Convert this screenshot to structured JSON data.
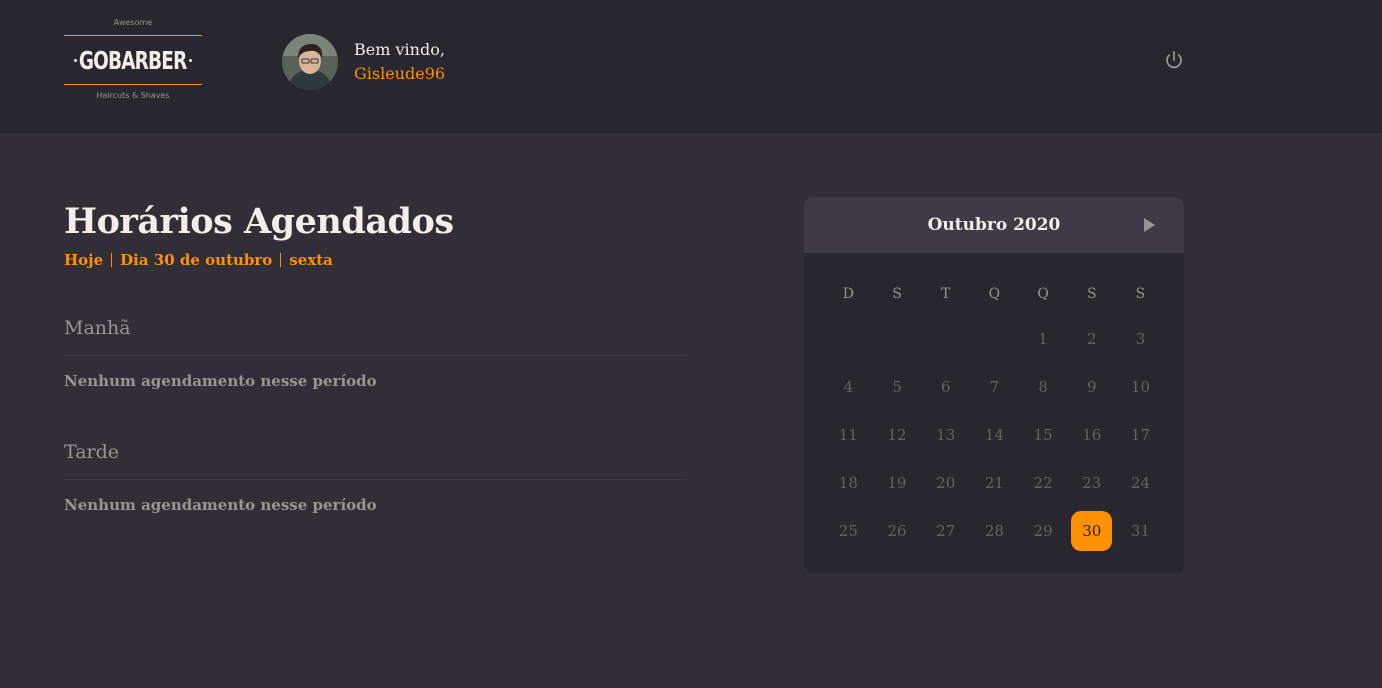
{
  "header": {
    "logo": {
      "top_text": "Awesome",
      "brand": "GOBARBER",
      "bottom_text": "Haircuts & Shaves"
    },
    "welcome": "Bem vindo,",
    "username": "Gisleude96",
    "power_icon": "power-icon"
  },
  "schedule": {
    "title": "Horários Agendados",
    "date": {
      "today": "Hoje",
      "day": "Dia 30 de outubro",
      "weekday": "sexta"
    },
    "sections": [
      {
        "title": "Manhã",
        "empty": "Nenhum agendamento nesse período"
      },
      {
        "title": "Tarde",
        "empty": "Nenhum agendamento nesse período"
      }
    ]
  },
  "calendar": {
    "month": "Outubro 2020",
    "next_icon": "triangle-right-icon",
    "weekdays": [
      "D",
      "S",
      "T",
      "Q",
      "Q",
      "S",
      "S"
    ],
    "weeks": [
      [
        "",
        "",
        "",
        "",
        "1",
        "2",
        "3"
      ],
      [
        "4",
        "5",
        "6",
        "7",
        "8",
        "9",
        "10"
      ],
      [
        "11",
        "12",
        "13",
        "14",
        "15",
        "16",
        "17"
      ],
      [
        "18",
        "19",
        "20",
        "21",
        "22",
        "23",
        "24"
      ],
      [
        "25",
        "26",
        "27",
        "28",
        "29",
        "30",
        "31"
      ]
    ],
    "selected": "30"
  },
  "colors": {
    "background": "#312e38",
    "header": "#28262e",
    "accent": "#ff9000",
    "muted": "#999591",
    "text": "#f4ede8"
  }
}
